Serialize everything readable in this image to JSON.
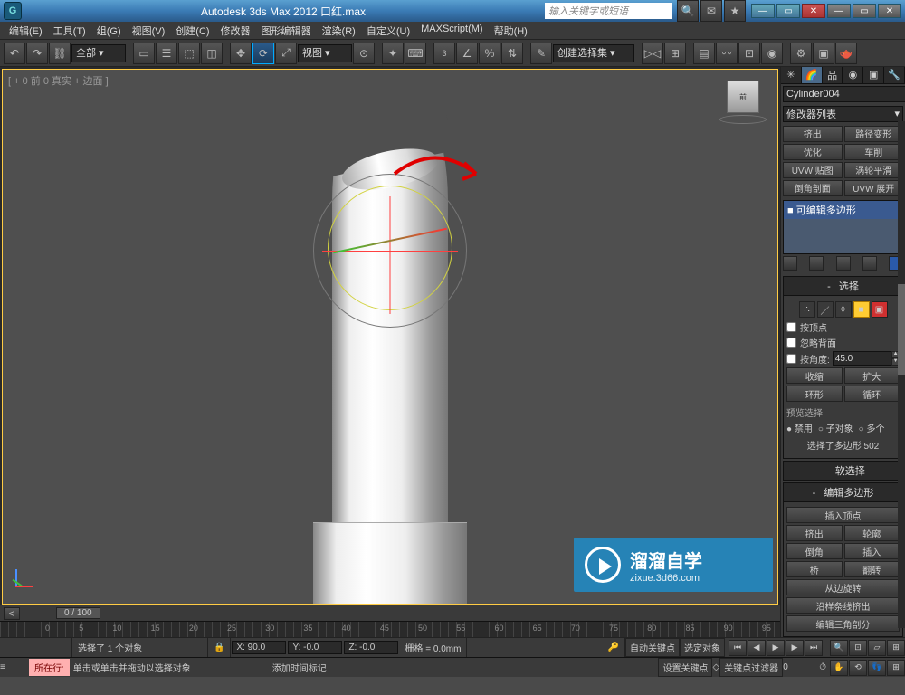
{
  "titlebar": {
    "app_title": "Autodesk 3ds Max 2012           口红.max",
    "search_placeholder": "输入关键字或短语",
    "logo": "G"
  },
  "menu": [
    "编辑(E)",
    "工具(T)",
    "组(G)",
    "视图(V)",
    "创建(C)",
    "修改器",
    "图形编辑器",
    "渲染(R)",
    "自定义(U)",
    "MAXScript(M)",
    "帮助(H)"
  ],
  "toolbar": {
    "selset_dd": "全部",
    "view_dd": "视图",
    "cmdset_dd": "创建选择集"
  },
  "viewport": {
    "label": "[ + 0 前 0 真实 + 边面 ]",
    "viewcube": "前"
  },
  "cmdpanel": {
    "objname": "Cylinder004",
    "modlist": "修改器列表",
    "buttons": {
      "b1": "挤出",
      "b2": "路径变形",
      "b3": "优化",
      "b4": "车削",
      "b5": "UVW 贴图",
      "b6": "涡轮平滑",
      "b7": "倒角剖面",
      "b8": "UVW 展开"
    },
    "stack_item": "可编辑多边形",
    "rollouts": {
      "select_hd": "选择",
      "byvertex": "按顶点",
      "ignoreback": "忽略背面",
      "byangle": "按角度:",
      "angle_val": "45.0",
      "shrink": "收缩",
      "grow": "扩大",
      "ring": "环形",
      "loop": "循环",
      "preview_hd": "预览选择",
      "r_off": "禁用",
      "r_sub": "子对象",
      "r_multi": "多个",
      "sel_info": "选择了多边形 502",
      "softsel_hd": "软选择",
      "editpoly_hd": "编辑多边形",
      "insvert": "插入顶点",
      "extrude": "挤出",
      "outline": "轮廓",
      "bevel": "倒角",
      "inset": "插入",
      "bridge": "桥",
      "flip": "翻转",
      "hinge": "从边旋转",
      "extrspline": "沿样条线挤出",
      "editsel": "编辑三角剖分"
    }
  },
  "timeline": {
    "pos": "0 / 100",
    "ticks": [
      "0",
      "5",
      "10",
      "15",
      "20",
      "25",
      "30",
      "35",
      "40",
      "45",
      "50",
      "55",
      "60",
      "65",
      "70",
      "75",
      "80",
      "85",
      "90",
      "95"
    ]
  },
  "status": {
    "sel": "选择了 1 个对象",
    "x": "X: 90.0",
    "y": "Y: -0.0",
    "z": "Z: -0.0",
    "grid": "栅格 = 0.0mm",
    "autokey": "自动关键点",
    "selkey": "选定对象",
    "setkey": "设置关键点",
    "keyfilter": "关键点过滤器",
    "tag": "所在行:",
    "prompt": "单击或单击并拖动以选择对象",
    "addmark": "添加时间标记"
  },
  "watermark": {
    "big": "溜溜自学",
    "small": "zixue.3d66.com"
  }
}
